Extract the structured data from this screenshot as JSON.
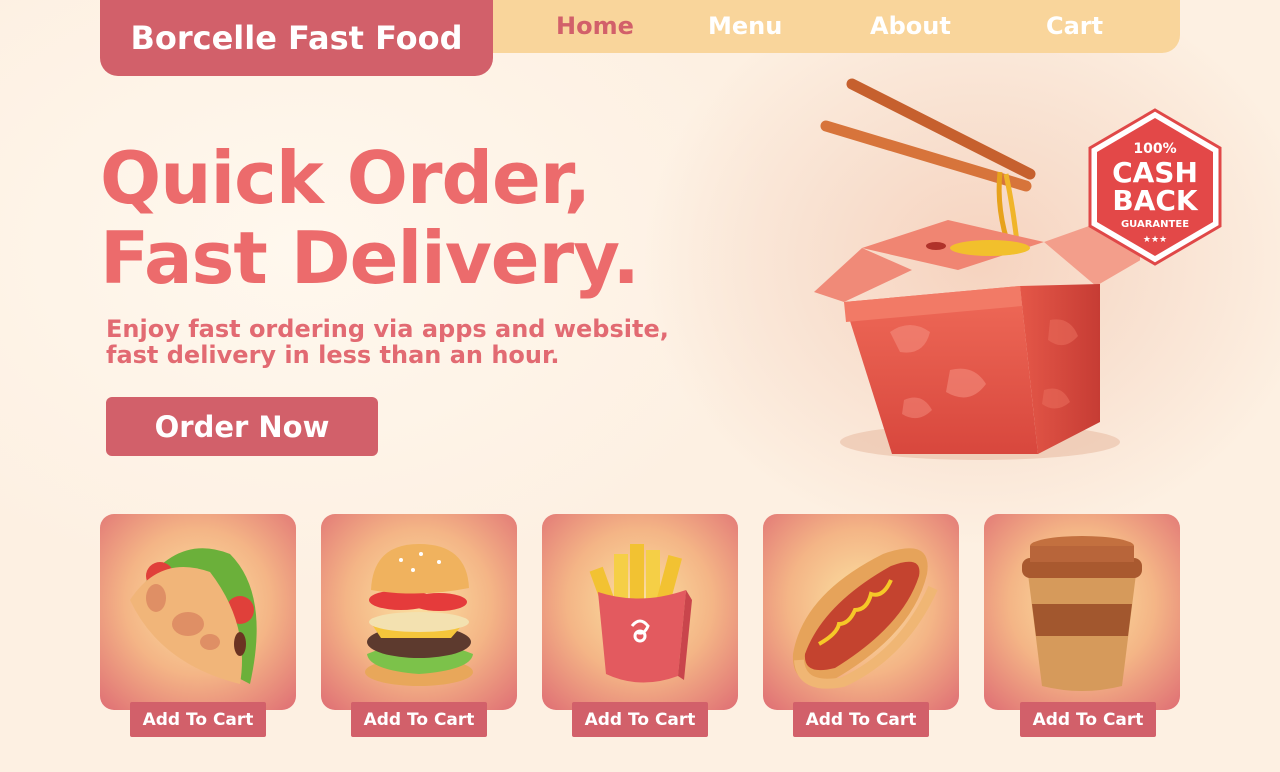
{
  "brand": {
    "name": "Borcelle Fast Food"
  },
  "nav": {
    "items": [
      {
        "label": "Home",
        "active": true
      },
      {
        "label": "Menu",
        "active": false
      },
      {
        "label": "About",
        "active": false
      },
      {
        "label": "Cart",
        "active": false
      }
    ]
  },
  "hero": {
    "title_line1": "Quick Order,",
    "title_line2": "Fast Delivery.",
    "subtitle_line1": "Enjoy fast ordering via apps and website,",
    "subtitle_line2": "fast delivery in less than an hour.",
    "cta_label": "Order Now",
    "badge": {
      "line1": "100%",
      "line2": "CASH",
      "line3": "BACK",
      "line4": "GUARANTEE"
    }
  },
  "products": [
    {
      "icon": "taco-icon",
      "button_label": "Add To Cart"
    },
    {
      "icon": "burger-icon",
      "button_label": "Add To Cart"
    },
    {
      "icon": "fries-icon",
      "button_label": "Add To Cart"
    },
    {
      "icon": "hotdog-icon",
      "button_label": "Add To Cart"
    },
    {
      "icon": "coffee-cup-icon",
      "button_label": "Add To Cart"
    }
  ],
  "colors": {
    "accent": "#d2606a",
    "title": "#ec6b6c",
    "nav_bg": "#f9d59b",
    "background": "#fdf0e2"
  }
}
